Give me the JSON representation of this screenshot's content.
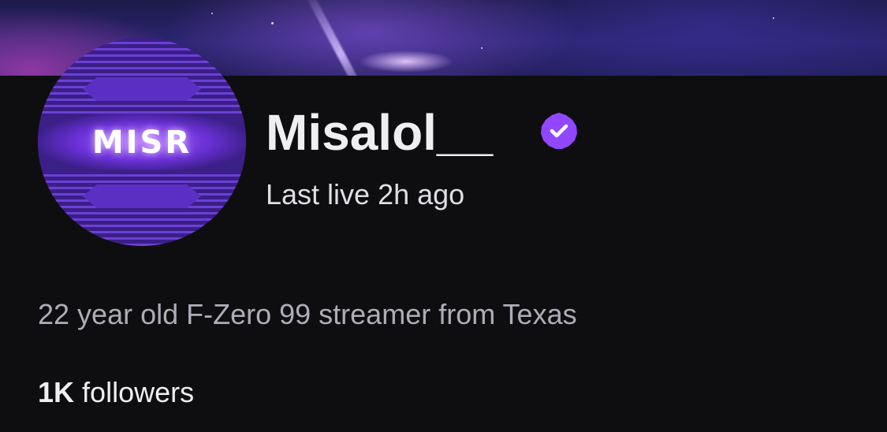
{
  "channel": {
    "username": "Misalol__",
    "avatar_logo_text": "MISR",
    "verified": true,
    "status": "Last live 2h ago",
    "bio": "22 year old F-Zero 99 streamer from Texas",
    "followers_count": "1K",
    "followers_label": "followers"
  },
  "icons": {
    "verified": "verified-badge-icon"
  },
  "colors": {
    "background": "#0e0e10",
    "accent": "#9147ff",
    "text_primary": "#efeff1",
    "text_secondary": "#adadb8"
  }
}
